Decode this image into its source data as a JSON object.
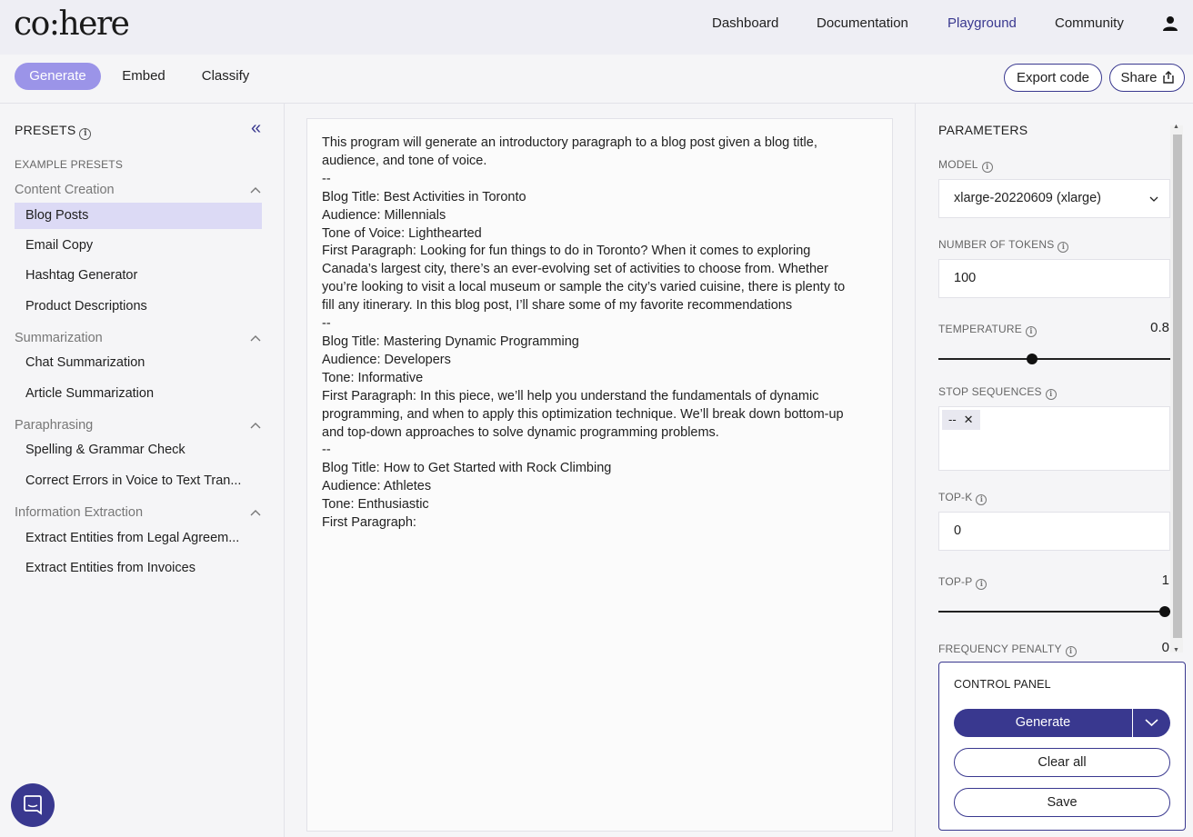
{
  "brand": {
    "logo": "co:here",
    "accent": "#39388f",
    "accent_light": "#9b94e8"
  },
  "topnav": {
    "links": [
      "Dashboard",
      "Documentation",
      "Playground",
      "Community"
    ],
    "active": "Playground"
  },
  "subbar": {
    "tabs": [
      "Generate",
      "Embed",
      "Classify"
    ],
    "active_tab": "Generate",
    "export_label": "Export code",
    "share_label": "Share"
  },
  "sidebar": {
    "title": "PRESETS",
    "example_label": "EXAMPLE PRESETS",
    "groups": [
      {
        "title": "Content Creation",
        "items": [
          "Blog Posts",
          "Email Copy",
          "Hashtag Generator",
          "Product Descriptions"
        ]
      },
      {
        "title": "Summarization",
        "items": [
          "Chat Summarization",
          "Article Summarization"
        ]
      },
      {
        "title": "Paraphrasing",
        "items": [
          "Spelling & Grammar Check",
          "Correct Errors in Voice to Text Tran..."
        ]
      },
      {
        "title": "Information Extraction",
        "items": [
          "Extract Entities from Legal Agreem...",
          "Extract Entities from Invoices"
        ]
      }
    ],
    "selected_item": "Blog Posts"
  },
  "editor": {
    "lines": [
      "This program will generate an introductory paragraph to a blog post given a blog title,",
      "audience, and tone of voice.",
      "--",
      "Blog Title: Best Activities in Toronto",
      "Audience: Millennials",
      "Tone of Voice: Lighthearted",
      "First Paragraph: Looking for fun things to do in Toronto? When it comes to exploring",
      "Canada’s largest city, there’s an ever-evolving set of activities to choose from. Whether",
      "you’re looking to visit a local museum or sample the city’s varied cuisine, there is plenty to",
      "fill any itinerary. In this blog post, I’ll share some of my favorite recommendations",
      "--",
      "Blog Title: Mastering Dynamic Programming",
      "Audience: Developers",
      "Tone: Informative",
      "First Paragraph: In this piece, we’ll help you understand the fundamentals of dynamic",
      "programming, and when to apply this optimization technique. We’ll break down bottom-up",
      "and top-down approaches to solve dynamic programming problems.",
      "--",
      "Blog Title: How to Get Started with Rock Climbing",
      "Audience: Athletes",
      "Tone: Enthusiastic",
      "First Paragraph:"
    ]
  },
  "params": {
    "title": "PARAMETERS",
    "model": {
      "label": "MODEL",
      "value": "xlarge-20220609 (xlarge)"
    },
    "tokens": {
      "label": "NUMBER OF TOKENS",
      "value": "100"
    },
    "temperature": {
      "label": "TEMPERATURE",
      "value": "0.8",
      "fraction": 0.4
    },
    "stop_sequences": {
      "label": "STOP SEQUENCES",
      "chips": [
        "--"
      ]
    },
    "top_k": {
      "label": "TOP-K",
      "value": "0"
    },
    "top_p": {
      "label": "TOP-P",
      "value": "1",
      "fraction": 1.0
    },
    "frequency_penalty": {
      "label": "FREQUENCY PENALTY",
      "value": "0"
    }
  },
  "control_panel": {
    "title": "CONTROL PANEL",
    "generate_label": "Generate",
    "clear_label": "Clear all",
    "save_label": "Save"
  }
}
